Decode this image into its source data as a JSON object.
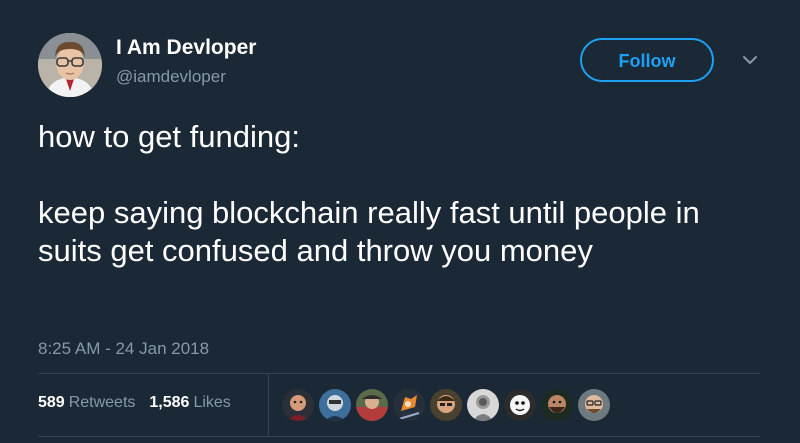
{
  "author": {
    "display_name": "I Am Devloper",
    "handle": "@iamdevloper"
  },
  "follow_button": {
    "label": "Follow"
  },
  "tweet": {
    "line1": "how to get funding:",
    "line2": "keep saying blockchain really fast until people in suits get confused and throw you money",
    "timestamp": "8:25 AM - 24 Jan 2018"
  },
  "stats": {
    "retweets_count": "589",
    "retweets_label": "Retweets",
    "likes_count": "1,586",
    "likes_label": "Likes"
  },
  "colors": {
    "background": "#1b2836",
    "accent": "#1da1f2",
    "secondary_text": "#8899a6",
    "divider": "#38444d"
  },
  "icons": {
    "menu_caret": "chevron-down-icon"
  }
}
